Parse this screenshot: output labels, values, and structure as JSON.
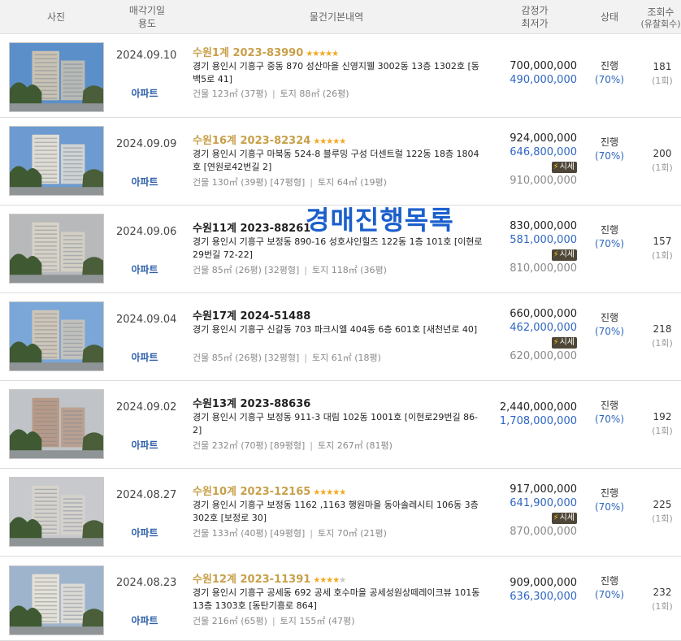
{
  "header": {
    "photo": "사진",
    "date_line1": "매각기일",
    "date_line2": "용도",
    "info": "물건기본내역",
    "price_line1": "감정가",
    "price_line2": "최저가",
    "status": "상태",
    "views_line1": "조회수",
    "views_line2": "(유찰회수)"
  },
  "overlay_text": "경매진행목록",
  "listings": [
    {
      "date": "2024.09.10",
      "usage": "아파트",
      "case_no": "수원1계 2023-83990",
      "case_color": "gold",
      "stars": 5,
      "address": "경기 용인시 기흥구 중동 870 성산마을 신영지웰 3002동 13층 1302호 [동백5로 41]",
      "building": "건물 123㎡ (37평)",
      "land": "토지 88㎡ (26평)",
      "appraisal": "700,000,000",
      "minimum": "490,000,000",
      "market_badge": "",
      "market_price": "",
      "status": "진행",
      "ratio": "(70%)",
      "views": "181",
      "fail_count": "(1회)"
    },
    {
      "date": "2024.09.09",
      "usage": "아파트",
      "case_no": "수원16계 2023-82324",
      "case_color": "gold",
      "stars": 5,
      "address": "경기 용인시 기흥구 마북동 524-8 블루밍 구성 더센트럴 122동 18층 1804호 [연원로42번길 2]",
      "building": "건물 130㎡ (39평) [47평형]",
      "land": "토지 64㎡ (19평)",
      "appraisal": "924,000,000",
      "minimum": "646,800,000",
      "market_badge": "시세",
      "market_price": "910,000,000",
      "status": "진행",
      "ratio": "(70%)",
      "views": "200",
      "fail_count": "(1회)"
    },
    {
      "date": "2024.09.06",
      "usage": "아파트",
      "case_no": "수원11계 2023-88261",
      "case_color": "dark",
      "stars": 0,
      "address": "경기 용인시 기흥구 보정동 890-16 성호샤인힐즈 122동 1층 101호 [이현로29번길 72-22]",
      "building": "건물 85㎡ (26평) [32평형]",
      "land": "토지 118㎡ (36평)",
      "appraisal": "830,000,000",
      "minimum": "581,000,000",
      "market_badge": "시세",
      "market_price": "810,000,000",
      "status": "진행",
      "ratio": "(70%)",
      "views": "157",
      "fail_count": "(1회)"
    },
    {
      "date": "2024.09.04",
      "usage": "아파트",
      "case_no": "수원17계 2024-51488",
      "case_color": "dark",
      "stars": 0,
      "address": "경기 용인시 기흥구 신갈동 703 파크시엘 404동 6층 601호 [새천년로 40]",
      "building": "건물 85㎡ (26평) [32평형]",
      "land": "토지 61㎡ (18평)",
      "appraisal": "660,000,000",
      "minimum": "462,000,000",
      "market_badge": "시세",
      "market_price": "620,000,000",
      "status": "진행",
      "ratio": "(70%)",
      "views": "218",
      "fail_count": "(1회)"
    },
    {
      "date": "2024.09.02",
      "usage": "아파트",
      "case_no": "수원13계 2023-88636",
      "case_color": "dark",
      "stars": 0,
      "address": "경기 용인시 기흥구 보정동 911-3 대림 102동 1001호 [이현로29번길 86-2]",
      "building": "건물 232㎡ (70평) [89평형]",
      "land": "토지 267㎡ (81평)",
      "appraisal": "2,440,000,000",
      "minimum": "1,708,000,000",
      "market_badge": "",
      "market_price": "",
      "status": "진행",
      "ratio": "(70%)",
      "views": "192",
      "fail_count": "(1회)"
    },
    {
      "date": "2024.08.27",
      "usage": "아파트",
      "case_no": "수원10계 2023-12165",
      "case_color": "gold",
      "stars": 5,
      "address": "경기 용인시 기흥구 보정동 1162 ,1163 행원마을 동아솔레시티 106동 3층 302호 [보정로 30]",
      "building": "건물 133㎡ (40평) [49평형]",
      "land": "토지 70㎡ (21평)",
      "appraisal": "917,000,000",
      "minimum": "641,900,000",
      "market_badge": "시세",
      "market_price": "870,000,000",
      "status": "진행",
      "ratio": "(70%)",
      "views": "225",
      "fail_count": "(1회)"
    },
    {
      "date": "2024.08.23",
      "usage": "아파트",
      "case_no": "수원12계 2023-11391",
      "case_color": "gold",
      "stars": 4,
      "address": "경기 용인시 기흥구 공세동 692 공세 호수마을 공세성원상떼레이크뷰 101동 13층 1303호 [동탄기흥로 864]",
      "building": "건물 216㎡ (65평)",
      "land": "토지 155㎡ (47평)",
      "appraisal": "909,000,000",
      "minimum": "636,300,000",
      "market_badge": "",
      "market_price": "",
      "status": "진행",
      "ratio": "(70%)",
      "views": "232",
      "fail_count": "(1회)"
    }
  ],
  "colors": {
    "header_bg": "#f2f2f2",
    "gold_case": "#c8a04a",
    "min_price": "#2f66c2",
    "overlay": "#1b5fcc",
    "star": "#f3a81f",
    "badge_bg": "#4e4637"
  },
  "icons": {
    "rating": "star-icon",
    "market": "lightning-icon"
  }
}
